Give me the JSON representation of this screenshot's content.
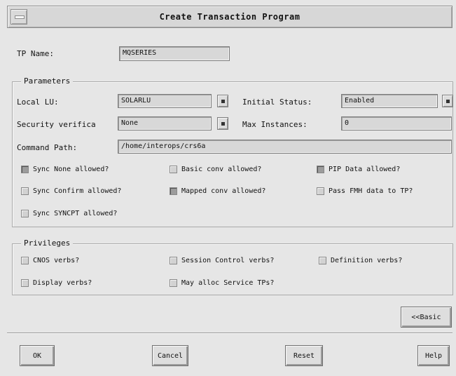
{
  "window": {
    "title": "Create Transaction Program"
  },
  "tp_name": {
    "label": "TP Name:",
    "value": "MQSERIES"
  },
  "parameters": {
    "title": "Parameters",
    "local_lu": {
      "label": "Local LU:",
      "value": "SOLARLU"
    },
    "initial_status": {
      "label": "Initial Status:",
      "value": "Enabled"
    },
    "security_verification": {
      "label": "Security verifica",
      "value": "None"
    },
    "max_instances": {
      "label": "Max Instances:",
      "value": "0"
    },
    "command_path": {
      "label": "Command Path:",
      "value": "/home/interops/crs6a"
    },
    "checks": {
      "sync_none": {
        "label": "Sync None allowed?",
        "checked": true
      },
      "basic_conv": {
        "label": "Basic conv allowed?",
        "checked": false
      },
      "pip_data": {
        "label": "PIP Data allowed?",
        "checked": true
      },
      "sync_confirm": {
        "label": "Sync Confirm allowed?",
        "checked": false
      },
      "mapped_conv": {
        "label": "Mapped conv allowed?",
        "checked": true
      },
      "pass_fmh": {
        "label": "Pass FMH data to TP?",
        "checked": false
      },
      "sync_syncpt": {
        "label": "Sync SYNCPT allowed?",
        "checked": false
      }
    }
  },
  "privileges": {
    "title": "Privileges",
    "checks": {
      "cnos_verbs": {
        "label": "CNOS verbs?",
        "checked": false
      },
      "session_control": {
        "label": "Session Control verbs?",
        "checked": false
      },
      "definition_verbs": {
        "label": "Definition verbs?",
        "checked": false
      },
      "display_verbs": {
        "label": "Display verbs?",
        "checked": false
      },
      "may_alloc": {
        "label": "May alloc Service TPs?",
        "checked": false
      }
    }
  },
  "buttons": {
    "basic": "<<Basic",
    "ok": "OK",
    "cancel": "Cancel",
    "reset": "Reset",
    "help": "Help"
  }
}
